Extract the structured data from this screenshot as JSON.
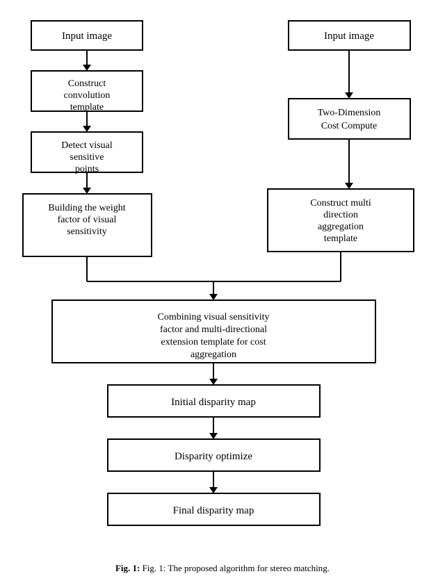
{
  "diagram": {
    "title": "Flowchart",
    "nodes": {
      "input_image_left": "Input image",
      "input_image_right": "Input image",
      "construct_convolution": "Construct convolution template",
      "two_dimension": "Two-Dimension Cost Compute",
      "detect_visual": "Detect visual sensitive points",
      "building_weight": "Building the weight factor of visual sensitivity",
      "construct_multi": "Construct multi direction aggregation template",
      "combining": "Combining visual sensitivity factor and multi-directional extension template for cost aggregation",
      "initial_disparity": "Initial disparity map",
      "disparity_optimize": "Disparity optimize",
      "final_disparity": "Final disparity map"
    },
    "caption": "Fig. 1: The proposed algorithm for stereo matching."
  }
}
